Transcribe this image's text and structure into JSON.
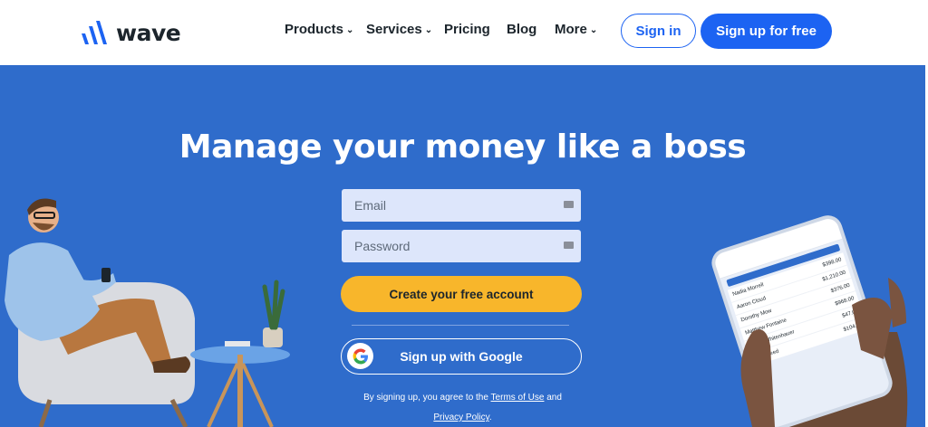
{
  "brand": {
    "name": "wave",
    "accent": "#1c63f2",
    "hero_bg": "#2f6ccb",
    "cta": "#f8b62b"
  },
  "nav": {
    "items": [
      {
        "label": "Products",
        "dropdown": true
      },
      {
        "label": "Services",
        "dropdown": true
      },
      {
        "label": "Pricing",
        "dropdown": false
      },
      {
        "label": "Blog",
        "dropdown": false
      },
      {
        "label": "More",
        "dropdown": true
      }
    ],
    "signin_label": "Sign in",
    "signup_label": "Sign up for free"
  },
  "hero": {
    "headline": "Manage your money like a boss",
    "email_placeholder": "Email",
    "password_placeholder": "Password",
    "create_label": "Create your free account",
    "google_label": "Sign up with Google",
    "legal_prefix": "By signing up, you agree to the",
    "terms_label": "Terms of Use",
    "legal_and": "and",
    "privacy_label": "Privacy Policy",
    "legal_suffix": "."
  },
  "phone": {
    "rows": [
      {
        "name": "Nadia Morrell",
        "amount": "$398.00"
      },
      {
        "name": "Aaron Cloud",
        "amount": "$1,210.00"
      },
      {
        "name": "Dorothy Mow",
        "amount": "$376.00"
      },
      {
        "name": "Matthew Fontaine",
        "amount": "$968.00"
      },
      {
        "name": "Jenna Whitenhauer",
        "amount": "$47.00"
      },
      {
        "name": "Wool Feed",
        "amount": "$104.00"
      }
    ]
  }
}
